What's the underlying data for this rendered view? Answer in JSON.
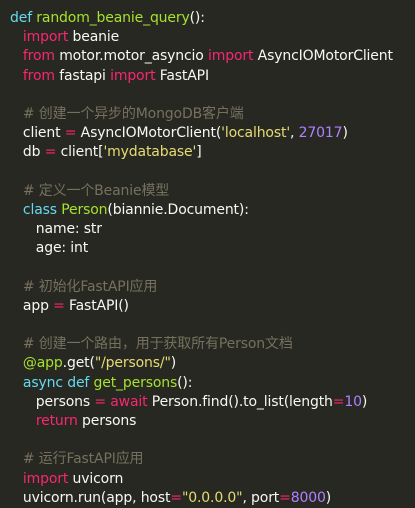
{
  "editor": {
    "lines": [
      {
        "tokens": [
          {
            "t": "def",
            "c": "def"
          },
          {
            "t": " ",
            "c": "plain"
          },
          {
            "t": "random_beanie_query",
            "c": "fn"
          },
          {
            "t": "():",
            "c": "plain"
          }
        ]
      },
      {
        "tokens": [
          {
            "t": "   ",
            "c": "plain"
          },
          {
            "t": "import",
            "c": "kw"
          },
          {
            "t": " beanie",
            "c": "plain"
          }
        ]
      },
      {
        "tokens": [
          {
            "t": "   ",
            "c": "plain"
          },
          {
            "t": "from",
            "c": "kw"
          },
          {
            "t": " motor.motor_asyncio ",
            "c": "plain"
          },
          {
            "t": "import",
            "c": "kw"
          },
          {
            "t": " AsyncIOMotorClient",
            "c": "plain"
          }
        ]
      },
      {
        "tokens": [
          {
            "t": "   ",
            "c": "plain"
          },
          {
            "t": "from",
            "c": "kw"
          },
          {
            "t": " fastapi ",
            "c": "plain"
          },
          {
            "t": "import",
            "c": "kw"
          },
          {
            "t": " FastAPI",
            "c": "plain"
          }
        ]
      },
      {
        "tokens": []
      },
      {
        "tokens": [
          {
            "t": "   # 创建一个异步的MongoDB客户端",
            "c": "comment"
          }
        ]
      },
      {
        "tokens": [
          {
            "t": "   client ",
            "c": "plain"
          },
          {
            "t": "=",
            "c": "kw"
          },
          {
            "t": " AsyncIOMotorClient(",
            "c": "plain"
          },
          {
            "t": "'localhost'",
            "c": "str"
          },
          {
            "t": ", ",
            "c": "plain"
          },
          {
            "t": "27017",
            "c": "num"
          },
          {
            "t": ")",
            "c": "plain"
          }
        ]
      },
      {
        "tokens": [
          {
            "t": "   db ",
            "c": "plain"
          },
          {
            "t": "=",
            "c": "kw"
          },
          {
            "t": " client[",
            "c": "plain"
          },
          {
            "t": "'mydatabase'",
            "c": "str"
          },
          {
            "t": "]",
            "c": "plain"
          }
        ]
      },
      {
        "tokens": []
      },
      {
        "tokens": [
          {
            "t": "   # 定义一个Beanie模型",
            "c": "comment"
          }
        ]
      },
      {
        "tokens": [
          {
            "t": "   ",
            "c": "plain"
          },
          {
            "t": "class",
            "c": "def"
          },
          {
            "t": " ",
            "c": "plain"
          },
          {
            "t": "Person",
            "c": "cls"
          },
          {
            "t": "(biannie.Document):",
            "c": "plain"
          }
        ]
      },
      {
        "tokens": [
          {
            "t": "      name: str",
            "c": "plain"
          }
        ]
      },
      {
        "tokens": [
          {
            "t": "      age: int",
            "c": "plain"
          }
        ]
      },
      {
        "tokens": []
      },
      {
        "tokens": [
          {
            "t": "   # 初始化FastAPI应用",
            "c": "comment"
          }
        ]
      },
      {
        "tokens": [
          {
            "t": "   app ",
            "c": "plain"
          },
          {
            "t": "=",
            "c": "kw"
          },
          {
            "t": " FastAPI()",
            "c": "plain"
          }
        ]
      },
      {
        "tokens": []
      },
      {
        "tokens": [
          {
            "t": "   # 创建一个路由，用于获取所有Person文档",
            "c": "comment"
          }
        ]
      },
      {
        "tokens": [
          {
            "t": "   ",
            "c": "plain"
          },
          {
            "t": "@app",
            "c": "fn"
          },
          {
            "t": ".get(",
            "c": "plain"
          },
          {
            "t": "\"/persons/\"",
            "c": "str"
          },
          {
            "t": ")",
            "c": "plain"
          }
        ]
      },
      {
        "tokens": [
          {
            "t": "   ",
            "c": "plain"
          },
          {
            "t": "async",
            "c": "def"
          },
          {
            "t": " ",
            "c": "plain"
          },
          {
            "t": "def",
            "c": "def"
          },
          {
            "t": " ",
            "c": "plain"
          },
          {
            "t": "get_persons",
            "c": "fn"
          },
          {
            "t": "():",
            "c": "plain"
          }
        ]
      },
      {
        "tokens": [
          {
            "t": "      persons ",
            "c": "plain"
          },
          {
            "t": "=",
            "c": "kw"
          },
          {
            "t": " ",
            "c": "plain"
          },
          {
            "t": "await",
            "c": "kw"
          },
          {
            "t": " Person.find().to_list(length",
            "c": "plain"
          },
          {
            "t": "=",
            "c": "kw"
          },
          {
            "t": "10",
            "c": "num"
          },
          {
            "t": ")",
            "c": "plain"
          }
        ]
      },
      {
        "tokens": [
          {
            "t": "      ",
            "c": "plain"
          },
          {
            "t": "return",
            "c": "kw"
          },
          {
            "t": " persons",
            "c": "plain"
          }
        ]
      },
      {
        "tokens": []
      },
      {
        "tokens": [
          {
            "t": "   # 运行FastAPI应用",
            "c": "comment"
          }
        ]
      },
      {
        "tokens": [
          {
            "t": "   ",
            "c": "plain"
          },
          {
            "t": "import",
            "c": "kw"
          },
          {
            "t": " uvicorn",
            "c": "plain"
          }
        ]
      },
      {
        "tokens": [
          {
            "t": "   uvicorn.run(app, host",
            "c": "plain"
          },
          {
            "t": "=",
            "c": "kw"
          },
          {
            "t": "\"0.0.0.0\"",
            "c": "str"
          },
          {
            "t": ", port",
            "c": "plain"
          },
          {
            "t": "=",
            "c": "kw"
          },
          {
            "t": "8000",
            "c": "num"
          },
          {
            "t": ")",
            "c": "plain"
          }
        ]
      }
    ]
  },
  "colors": {
    "background": "#272822",
    "plain": "#f8f8f2",
    "keyword": "#f92672",
    "definition": "#66d9ef",
    "function": "#a6e22e",
    "string": "#e6db74",
    "number": "#ae81ff",
    "comment": "#75715e"
  }
}
